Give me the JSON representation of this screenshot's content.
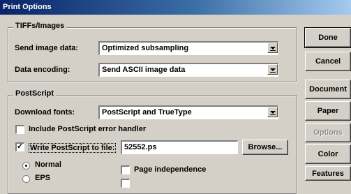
{
  "window": {
    "title": "Print Options"
  },
  "tiffs": {
    "legend": "TIFFs/Images",
    "send_label": "Send image data:",
    "send_value": "Optimized subsampling",
    "encoding_label": "Data encoding:",
    "encoding_value": "Send ASCII image data"
  },
  "postscript": {
    "legend": "PostScript",
    "fonts_label": "Download fonts:",
    "fonts_value": "PostScript and TrueType",
    "error_handler_label": "Include PostScript error handler",
    "error_handler_checked": false,
    "write_file_label": "Write PostScript to file:",
    "write_file_checked": true,
    "file_name": "52552.ps",
    "browse_label": "Browse...",
    "normal_label": "Normal",
    "eps_label": "EPS",
    "page_independence_label": "Page independence"
  },
  "buttons": {
    "done": "Done",
    "cancel": "Cancel",
    "document": "Document",
    "paper": "Paper",
    "options": "Options",
    "color": "Color",
    "features": "Features"
  }
}
